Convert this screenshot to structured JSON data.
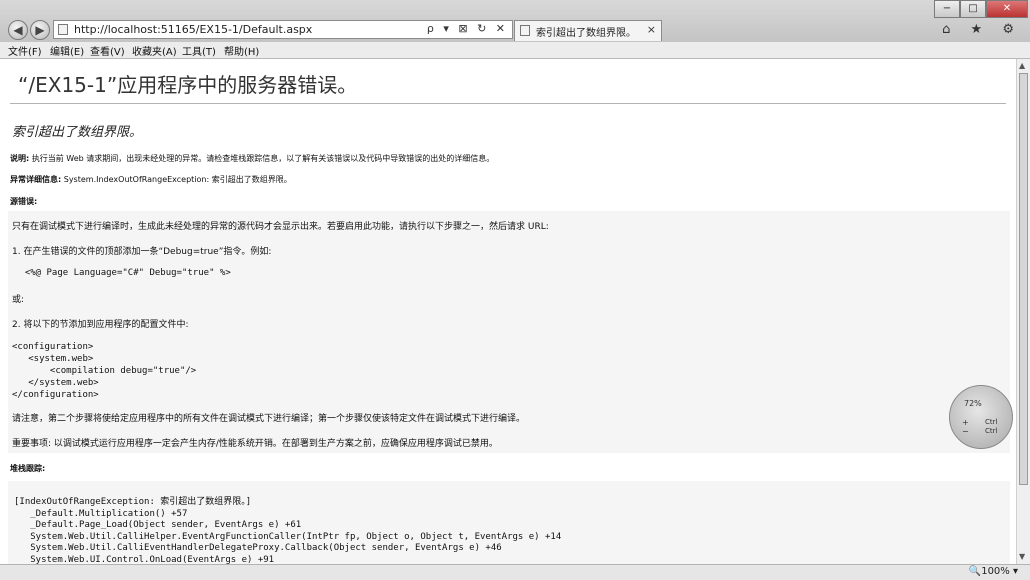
{
  "browser": {
    "url": "http://localhost:51165/EX15-1/Default.aspx",
    "address_tools": "ρ ▾ ⊠ ↻ ✕",
    "tab_title": "索引超出了数组界限。",
    "tab_close": "×",
    "window_buttons": {
      "minimize": "−",
      "maximize": "□",
      "close": "✕"
    },
    "right_tools": "⌂ ★ ⚙",
    "back_icon": "◀",
    "forward_icon": "▶"
  },
  "menubar": {
    "items": [
      "文件(F)",
      "编辑(E)",
      "查看(V)",
      "收藏夹(A)",
      "工具(T)",
      "帮助(H)"
    ]
  },
  "page": {
    "title": "“/EX15-1”应用程序中的服务器错误。",
    "subtitle": "索引超出了数组界限。",
    "description_label": "说明:",
    "description_text": " 执行当前 Web 请求期间，出现未经处理的异常。请检查堆栈跟踪信息，以了解有关该错误以及代码中导致错误的出处的详细信息。",
    "exception_label": "异常详细信息:",
    "exception_text": " System.IndexOutOfRangeException: 索引超出了数组界限。",
    "source_error_label": "源错误:",
    "source_box": {
      "intro": "只有在调试模式下进行编译时，生成此未经处理的异常的源代码才会显示出来。若要启用此功能，请执行以下步骤之一，然后请求 URL:",
      "step1": "1. 在产生错误的文件的顶部添加一条“Debug=true”指令。例如:",
      "code1": "  <%@ Page Language=\"C#\" Debug=\"true\" %>",
      "or": "或:",
      "step2": "2. 将以下的节添加到应用程序的配置文件中:",
      "code2": "<configuration>\n   <system.web>\n       <compilation debug=\"true\"/>\n   </system.web>\n</configuration>",
      "note1": "请注意，第二个步骤将使给定应用程序中的所有文件在调试模式下进行编译；第一个步骤仅使该特定文件在调试模式下进行编译。",
      "note2": "重要事项: 以调试模式运行应用程序一定会产生内存/性能系统开销。在部署到生产方案之前，应确保应用程序调试已禁用。"
    },
    "stack_label": "堆栈跟踪:",
    "stack_trace": "[IndexOutOfRangeException: 索引超出了数组界限。]\n   _Default.Multiplication() +57\n   _Default.Page_Load(Object sender, EventArgs e) +61\n   System.Web.Util.CalliHelper.EventArgFunctionCaller(IntPtr fp, Object o, Object t, EventArgs e) +14\n   System.Web.Util.CalliEventHandlerDelegateProxy.Callback(Object sender, EventArgs e) +46\n   System.Web.UI.Control.OnLoad(EventArgs e) +91"
  },
  "widget": {
    "percent": "72%",
    "plus_minus": "+\n−",
    "ctrl_labels": "Ctrl\nCtrl"
  },
  "status": {
    "zoom": "🔍100% ▾"
  }
}
